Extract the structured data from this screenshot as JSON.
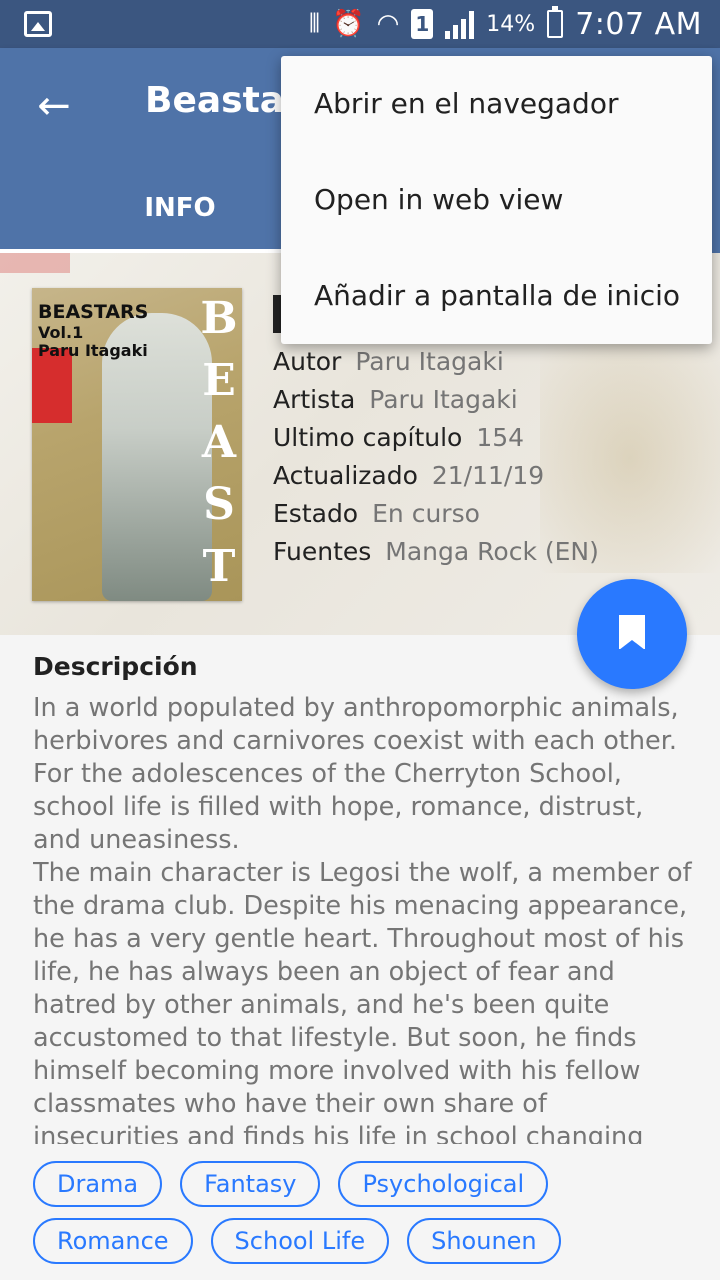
{
  "status_bar": {
    "battery_pct": "14%",
    "time": "7:07 AM",
    "sim_label": "1",
    "icons": [
      "image-notification-icon",
      "vibrate-icon",
      "alarm-icon",
      "wifi-icon",
      "sim-icon",
      "signal-icon",
      "battery-charging-icon"
    ]
  },
  "toolbar": {
    "back_icon": "arrow-back-icon",
    "title": "Beastars",
    "tabs": [
      {
        "label": "INFO"
      }
    ]
  },
  "manga": {
    "cover_title": "BEASTARS",
    "cover_volume": "Vol.1",
    "cover_author": "Paru Itagaki",
    "meta": [
      {
        "label": "Autor",
        "value": "Paru Itagaki"
      },
      {
        "label": "Artista",
        "value": "Paru Itagaki"
      },
      {
        "label": "Ultimo capítulo",
        "value": "154"
      },
      {
        "label": "Actualizado",
        "value": "21/11/19"
      },
      {
        "label": "Estado",
        "value": "En curso"
      },
      {
        "label": "Fuentes",
        "value": "Manga Rock (EN)"
      }
    ]
  },
  "fab": {
    "icon": "bookmark-icon"
  },
  "description": {
    "heading": "Descripción",
    "text": "In a world populated by anthropomorphic animals, herbivores and carnivores coexist with each other. For the adolescences of the Cherryton School, school life is filled with hope, romance, distrust, and uneasiness.\nThe main character is Legosi the wolf, a member of the drama club. Despite his menacing appearance, he has a very gentle heart. Throughout most of his life, he has always been an object of fear and hatred by other animals, and he's been quite accustomed to that lifestyle. But soon, he finds himself becoming more involved with his fellow classmates who have their own share of insecurities and finds his life in school changing slowly."
  },
  "genres": [
    "Drama",
    "Fantasy",
    "Psychological",
    "Romance",
    "School Life",
    "Shounen"
  ],
  "overflow_menu": {
    "items": [
      "Abrir en el navegador",
      "Open in web view",
      "Añadir a pantalla de inicio"
    ]
  },
  "colors": {
    "toolbar": "#4f73a8",
    "status_bar": "#3b5680",
    "accent": "#2979ff"
  }
}
